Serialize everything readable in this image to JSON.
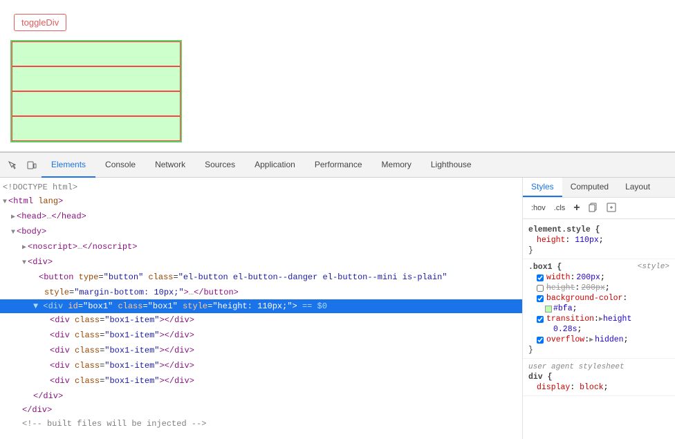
{
  "preview": {
    "toggle_btn_label": "toggleDiv"
  },
  "devtools": {
    "tabs": [
      {
        "id": "elements",
        "label": "Elements",
        "active": true
      },
      {
        "id": "console",
        "label": "Console",
        "active": false
      },
      {
        "id": "network",
        "label": "Network",
        "active": false
      },
      {
        "id": "sources",
        "label": "Sources",
        "active": false
      },
      {
        "id": "application",
        "label": "Application",
        "active": false
      },
      {
        "id": "performance",
        "label": "Performance",
        "active": false
      },
      {
        "id": "memory",
        "label": "Memory",
        "active": false
      },
      {
        "id": "lighthouse",
        "label": "Lighthouse",
        "active": false
      }
    ],
    "elements_panel": {
      "lines": [
        {
          "id": "doctype",
          "indent": 0,
          "text": "<!DOCTYPE html>",
          "type": "doctype"
        },
        {
          "id": "html",
          "indent": 0,
          "text": "<html lang>",
          "type": "open-tag"
        },
        {
          "id": "head",
          "indent": 1,
          "text": "<head>…</head>",
          "type": "collapsed"
        },
        {
          "id": "body",
          "indent": 1,
          "text": "<body>",
          "type": "open-tag"
        },
        {
          "id": "noscript",
          "indent": 2,
          "text": "<noscript>…</noscript>",
          "type": "collapsed"
        },
        {
          "id": "div1",
          "indent": 2,
          "text": "<div>",
          "type": "open-tag"
        },
        {
          "id": "button",
          "indent": 3,
          "text": "<button type=\"button\" class=\"el-button el-button--danger el-button--mini is-plain\"",
          "type": "open-tag-long"
        },
        {
          "id": "button-style",
          "indent": 4,
          "text": "style=\"margin-bottom: 10px;\">…</button>",
          "type": "attr-cont"
        },
        {
          "id": "div-box1",
          "indent": 3,
          "text": "<div id=\"box1\" class=\"box1\" style=\"height: 110px;\"> == $0",
          "type": "selected"
        },
        {
          "id": "box1-item1",
          "indent": 4,
          "text": "<div class=\"box1-item\"></div>",
          "type": "leaf"
        },
        {
          "id": "box1-item2",
          "indent": 4,
          "text": "<div class=\"box1-item\"></div>",
          "type": "leaf"
        },
        {
          "id": "box1-item3",
          "indent": 4,
          "text": "<div class=\"box1-item\"></div>",
          "type": "leaf"
        },
        {
          "id": "box1-item4",
          "indent": 4,
          "text": "<div class=\"box1-item\"></div>",
          "type": "leaf"
        },
        {
          "id": "box1-item5",
          "indent": 4,
          "text": "<div class=\"box1-item\"></div>",
          "type": "leaf"
        },
        {
          "id": "div-box1-close",
          "indent": 3,
          "text": "</div>",
          "type": "close-tag"
        },
        {
          "id": "div1-close",
          "indent": 2,
          "text": "</div>",
          "type": "close-tag"
        },
        {
          "id": "comment",
          "indent": 2,
          "text": "<!-- built files will be injected -->",
          "type": "comment"
        }
      ]
    },
    "styles_panel": {
      "tabs": [
        "Styles",
        "Computed",
        "Layout"
      ],
      "active_tab": "Styles",
      "toolbar_items": [
        ":hov",
        ".cls",
        "+"
      ],
      "rules": [
        {
          "id": "element-style",
          "selector": "element.style {",
          "properties": [
            {
              "name": "height",
              "value": "110px",
              "strikethrough": false
            }
          ],
          "close": "}"
        },
        {
          "id": "box1-rule",
          "selector": ".box1 {",
          "source": "<style>",
          "properties": [
            {
              "name": "width",
              "value": "200px",
              "strikethrough": false
            },
            {
              "name": "height",
              "value": "200px",
              "strikethrough": true
            },
            {
              "name": "background-color",
              "value": "#bfa",
              "strikethrough": false,
              "has_swatch": true
            },
            {
              "name": "transition",
              "value": "▶ height 0.28s",
              "strikethrough": false,
              "has_arrow": true
            },
            {
              "name": "overflow",
              "value": "▶ hidden",
              "strikethrough": false,
              "has_arrow": true
            }
          ],
          "close": "}"
        },
        {
          "id": "user-agent",
          "label": "user agent stylesheet",
          "selector": "div {",
          "properties": [
            {
              "name": "display",
              "value": "block",
              "strikethrough": false
            }
          ]
        }
      ]
    }
  }
}
